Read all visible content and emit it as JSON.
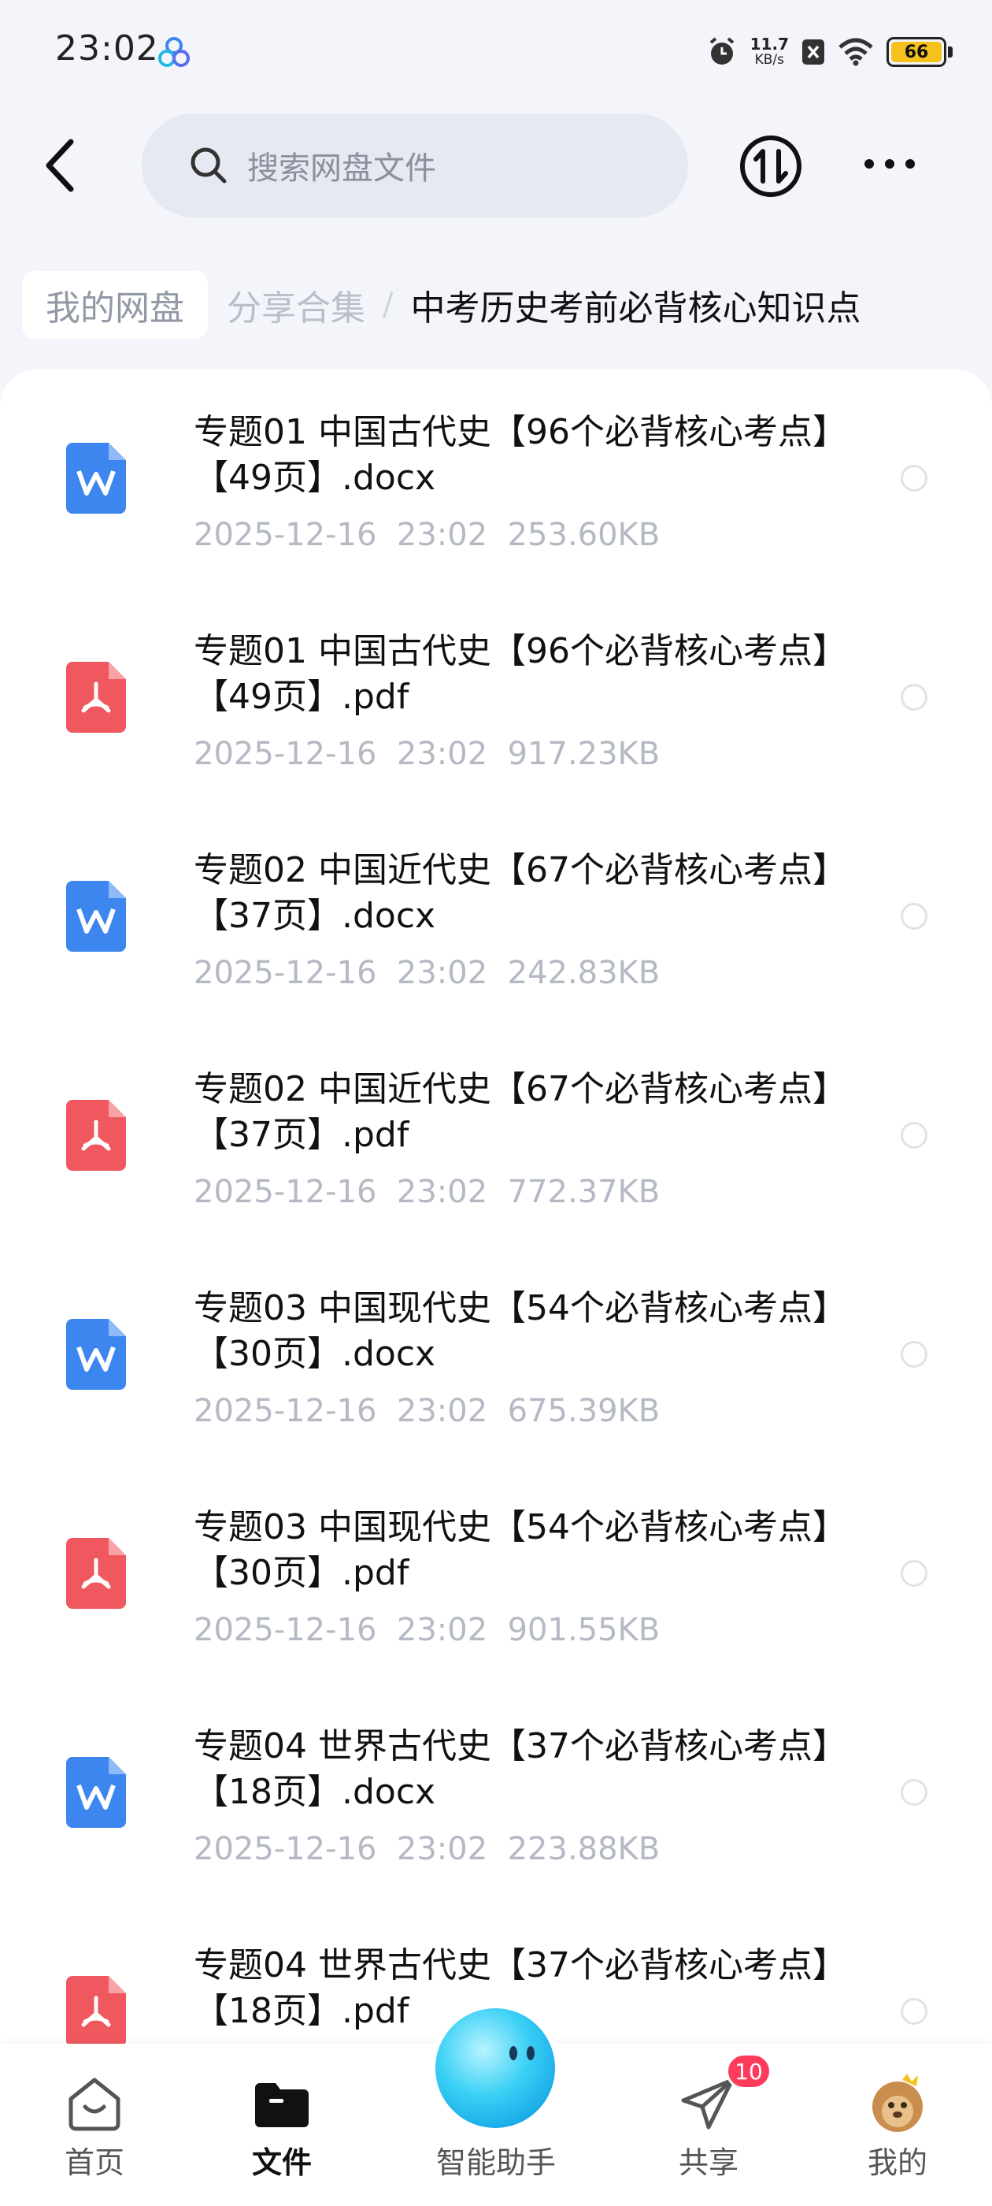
{
  "status_bar": {
    "time": "23:02",
    "net_speed_value": "11.7",
    "net_speed_unit": "KB/s",
    "battery": "66",
    "battery_color": "#f6c11d"
  },
  "header": {
    "search_placeholder": "搜索网盘文件"
  },
  "breadcrumb": {
    "home": "我的网盘",
    "parent": "分享合集",
    "separator": "/",
    "current": "中考历史考前必背核心知识点"
  },
  "files": [
    {
      "type": "docx",
      "icon": "word-icon",
      "name": "专题01 中国古代史【96个必背核心考点】【49页】.docx",
      "meta": "2025-12-16  23:02  253.60KB"
    },
    {
      "type": "pdf",
      "icon": "pdf-icon",
      "name": "专题01 中国古代史【96个必背核心考点】【49页】.pdf",
      "meta": "2025-12-16  23:02  917.23KB"
    },
    {
      "type": "docx",
      "icon": "word-icon",
      "name": "专题02 中国近代史【67个必背核心考点】【37页】.docx",
      "meta": "2025-12-16  23:02  242.83KB"
    },
    {
      "type": "pdf",
      "icon": "pdf-icon",
      "name": "专题02 中国近代史【67个必背核心考点】【37页】.pdf",
      "meta": "2025-12-16  23:02  772.37KB"
    },
    {
      "type": "docx",
      "icon": "word-icon",
      "name": "专题03 中国现代史【54个必背核心考点】【30页】.docx",
      "meta": "2025-12-16  23:02  675.39KB"
    },
    {
      "type": "pdf",
      "icon": "pdf-icon",
      "name": "专题03 中国现代史【54个必背核心考点】【30页】.pdf",
      "meta": "2025-12-16  23:02  901.55KB"
    },
    {
      "type": "docx",
      "icon": "word-icon",
      "name": "专题04 世界古代史【37个必背核心考点】【18页】.docx",
      "meta": "2025-12-16  23:02  223.88KB"
    },
    {
      "type": "pdf",
      "icon": "pdf-icon",
      "name": "专题04 世界古代史【37个必背核心考点】【18页】.pdf",
      "meta": ""
    }
  ],
  "bottom_nav": {
    "home": "首页",
    "files": "文件",
    "assistant": "智能助手",
    "share": "共享",
    "mine": "我的",
    "share_badge": "10"
  },
  "colors": {
    "word": "#3d86f0",
    "pdf": "#f0585f",
    "badge": "#ff3b5c"
  }
}
